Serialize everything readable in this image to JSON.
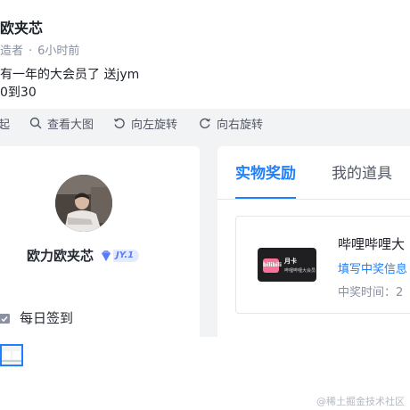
{
  "post": {
    "author_name": "欧夹芯",
    "role": "造者",
    "time": "6小时前",
    "lines": [
      "有一年的大会员了 送jym",
      "0到30"
    ]
  },
  "toolbar": {
    "collapse": "起",
    "view_large": "查看大图",
    "rotate_left": "向左旋转",
    "rotate_right": "向右旋转"
  },
  "profile": {
    "username": "欧力欧夹芯",
    "level": "JY.1",
    "checkin": "每日签到"
  },
  "prize_panel": {
    "tabs": [
      "实物奖励",
      "我的道具"
    ],
    "item": {
      "title": "哔哩哔哩大",
      "link": "填写中奖信息",
      "time_label": "中奖时间：",
      "time_value": "2",
      "card_logo": "bilibili",
      "card_title": "月卡",
      "card_subtitle": "哔哩哔哩大会员"
    }
  },
  "watermark": "@稀土掘金技术社区",
  "colors": {
    "accent": "#1e80ff",
    "toolbar_bg": "#f2f3f5",
    "muted": "#8a919f"
  }
}
